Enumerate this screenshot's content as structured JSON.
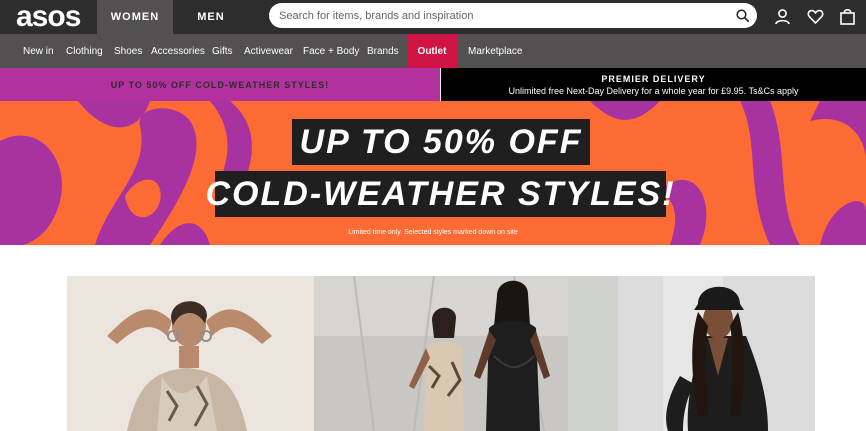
{
  "header": {
    "logo_text": "asos",
    "tabs": [
      {
        "label": "WOMEN",
        "active": true
      },
      {
        "label": "MEN",
        "active": false
      }
    ],
    "search": {
      "placeholder": "Search for items, brands and inspiration",
      "value": ""
    },
    "icons": [
      "search-icon",
      "account-icon",
      "heart-icon",
      "bag-icon"
    ]
  },
  "nav": {
    "items": [
      {
        "label": "New in"
      },
      {
        "label": "Clothing"
      },
      {
        "label": "Shoes"
      },
      {
        "label": "Accessories"
      },
      {
        "label": "Gifts"
      },
      {
        "label": "Activewear"
      },
      {
        "label": "Face + Body"
      },
      {
        "label": "Brands"
      },
      {
        "label": "Outlet",
        "highlight": true
      },
      {
        "label": "Marketplace"
      }
    ]
  },
  "promo_strip": {
    "left_text": "UP TO 50% OFF COLD-WEATHER STYLES!",
    "right_title": "PREMIER DELIVERY",
    "right_subtitle": "Unlimited free Next-Day Delivery for a whole year for £9.95. Ts&Cs apply"
  },
  "hero": {
    "line1": "UP TO 50% OFF",
    "line2": "COLD-WEATHER STYLES!",
    "fine_print": "Limited time only. Selected styles marked down on site"
  },
  "colors": {
    "header_bg": "#2d2d2d",
    "nav_bg": "#525050",
    "outlet_red": "#d01345",
    "promo_purple": "#b3319f",
    "hero_orange": "#fd6b34",
    "headline_bg": "#1f1f1f"
  }
}
